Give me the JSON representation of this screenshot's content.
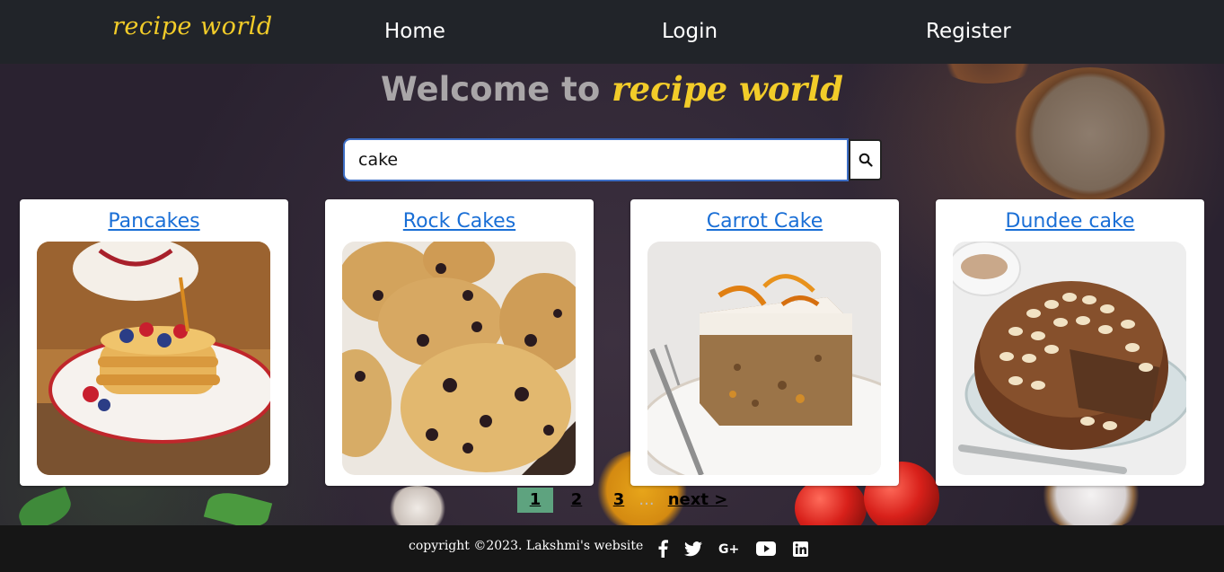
{
  "navbar": {
    "brand": "recipe world",
    "links": [
      "Home",
      "Login",
      "Register"
    ]
  },
  "hero": {
    "welcome_text": "Welcome to",
    "welcome_brand": "recipe world"
  },
  "search": {
    "value": "cake",
    "button_icon": "search-icon"
  },
  "recipes": [
    {
      "title": "Pancakes"
    },
    {
      "title": "Rock Cakes"
    },
    {
      "title": "Carrot Cake"
    },
    {
      "title": "Dundee cake"
    }
  ],
  "pagination": {
    "current": "1",
    "pages": [
      "1",
      "2",
      "3"
    ],
    "ellipsis": "...",
    "next": "next >"
  },
  "footer": {
    "copyright": "copyright ©2023. Lakshmi's website",
    "social_icons": [
      "facebook-icon",
      "twitter-icon",
      "google-plus-icon",
      "youtube-icon",
      "linkedin-icon"
    ]
  },
  "colors": {
    "navbar_bg": "#212429",
    "brand": "#f2cc29",
    "link": "#1a6fd6",
    "active_page": "#5ea37f",
    "footer_bg": "#161616"
  }
}
